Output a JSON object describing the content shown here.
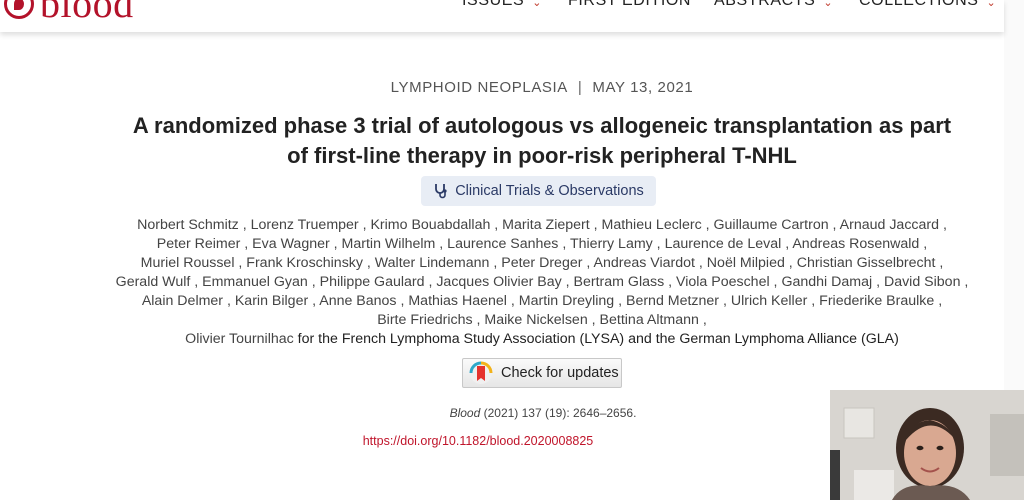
{
  "logo": {
    "text": "blood"
  },
  "nav": {
    "issues": "ISSUES",
    "first_edition": "FIRST EDITION",
    "abstracts": "ABSTRACTS",
    "collections": "COLLECTIONS"
  },
  "article": {
    "category": "LYMPHOID NEOPLASIA",
    "separator": "|",
    "date": "MAY 13, 2021",
    "title_line1": "A randomized phase 3 trial of autologous vs allogeneic transplantation as part",
    "title_line2": "of first-line therapy in poor-risk peripheral T-NHL",
    "badge": "Clinical Trials & Observations",
    "author_lines": [
      "Norbert Schmitz , Lorenz Truemper , Krimo Bouabdallah , Marita Ziepert , Mathieu Leclerc , Guillaume Cartron , Arnaud Jaccard ,",
      "Peter Reimer , Eva Wagner , Martin Wilhelm , Laurence Sanhes , Thierry Lamy , Laurence de Leval , Andreas Rosenwald ,",
      "Muriel Roussel , Frank Kroschinsky , Walter Lindemann , Peter Dreger , Andreas Viardot , Noël Milpied , Christian Gisselbrecht ,",
      "Gerald Wulf , Emmanuel Gyan , Philippe Gaulard , Jacques Olivier Bay , Bertram Glass , Viola Poeschel , Gandhi Damaj , David Sibon ,",
      "Alain Delmer , Karin Bilger , Anne Banos , Mathias Haenel , Martin Dreyling , Bernd Metzner , Ulrich Keller , Friederike Braulke ,",
      "Birte Friedrichs , Maike Nickelsen , Bettina Altmann ,"
    ],
    "last_author": "Olivier Tournilhac",
    "collab": " for the French Lymphoma Study Association (LYSA) and the German Lymphoma Alliance (GLA)",
    "check_updates": "Check for updates",
    "citation_journal": "Blood",
    "citation_rest": " (2021) 137 (19): 2646–2656.",
    "doi": "https://doi.org/10.1182/blood.2020008825"
  },
  "colors": {
    "brand_red": "#b3122a",
    "badge_bg": "#e8edf5",
    "doi_red": "#c0152b"
  },
  "icons": {
    "nav_chevron": "chevron-down-icon",
    "badge": "stethoscope-icon",
    "check_updates": "bookmark-update-icon"
  }
}
